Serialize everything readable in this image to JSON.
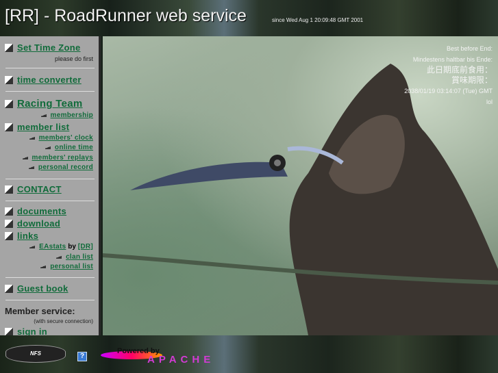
{
  "header": {
    "title": "[RR] - RoadRunner web service",
    "since": "since Wed Aug 1 20:09:48 GMT 2001"
  },
  "sidebar": {
    "set_time_zone": "Set Time Zone",
    "please_do_first": "please do first",
    "time_converter": "time converter",
    "racing_team": "Racing Team",
    "membership": "membership",
    "member_list": "member list",
    "members_clock": "members' clock",
    "online_time": "online time",
    "members_replays": "members' replays",
    "personal_record": "personal record",
    "contact": "CONTACT",
    "documents": "documents",
    "download": "download",
    "links": "links",
    "eastats": "EAstats",
    "by": "by",
    "dr": "[DR]",
    "clan_list": "clan list",
    "personal_list": "personal list",
    "guest_book": "Guest book",
    "member_service": "Member service:",
    "secure_note": "(with secure connection)",
    "sign_in": "sign in"
  },
  "photo_overlay": {
    "line1": "Best before End:",
    "line2": "Mindestens haltbar bis Ende:",
    "line3": "此日期底前食用：",
    "line4": "賞味期限：",
    "line5": "2038/01/19 03:14:07 (Tue) GMT",
    "line6": "lol"
  },
  "footer": {
    "nfs_logo": "NEED FOR SPEED PORSCHE UNLEASHED",
    "help_icon": "?",
    "powered_by": "Powered by",
    "apache": "APACHE"
  }
}
